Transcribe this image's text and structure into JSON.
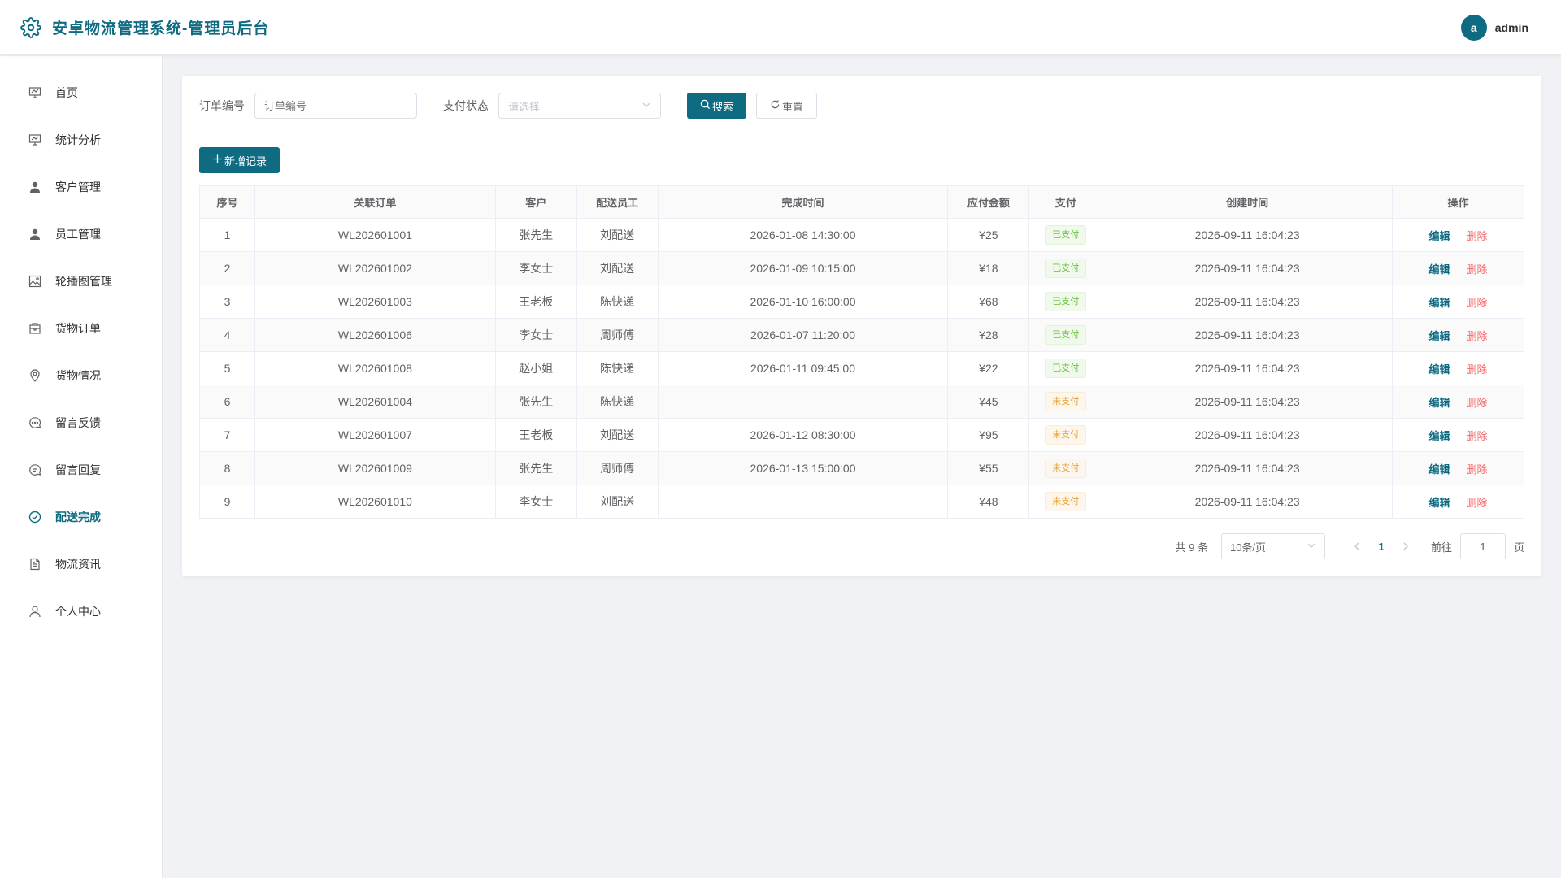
{
  "header": {
    "title": "安卓物流管理系统-管理员后台",
    "avatar_letter": "a",
    "username": "admin"
  },
  "sidebar": {
    "items": [
      {
        "label": "首页",
        "icon": "presentation-icon"
      },
      {
        "label": "统计分析",
        "icon": "presentation-icon"
      },
      {
        "label": "客户管理",
        "icon": "user-icon"
      },
      {
        "label": "员工管理",
        "icon": "user-icon"
      },
      {
        "label": "轮播图管理",
        "icon": "image-icon"
      },
      {
        "label": "货物订单",
        "icon": "box-icon"
      },
      {
        "label": "货物情况",
        "icon": "location-icon"
      },
      {
        "label": "留言反馈",
        "icon": "chat-dots-icon"
      },
      {
        "label": "留言回复",
        "icon": "chat-icon"
      },
      {
        "label": "配送完成",
        "icon": "circle-check-icon",
        "active": true
      },
      {
        "label": "物流资讯",
        "icon": "document-icon"
      },
      {
        "label": "个人中心",
        "icon": "user-outline-icon"
      }
    ]
  },
  "filters": {
    "order_label": "订单编号",
    "order_placeholder": "订单编号",
    "pay_label": "支付状态",
    "pay_placeholder": "请选择",
    "search_label": "搜索",
    "reset_label": "重置"
  },
  "add_label": "新增记录",
  "table": {
    "headers": [
      "序号",
      "关联订单",
      "客户",
      "配送员工",
      "完成时间",
      "应付金额",
      "支付",
      "创建时间",
      "操作"
    ],
    "edit_label": "编辑",
    "delete_label": "删除",
    "rows": [
      {
        "no": "1",
        "order": "WL202601001",
        "customer": "张先生",
        "staff": "刘配送",
        "done": "2026-01-08 14:30:00",
        "amount": "¥25",
        "pay": "已支付",
        "paid": true,
        "created": "2026-09-11 16:04:23"
      },
      {
        "no": "2",
        "order": "WL202601002",
        "customer": "李女士",
        "staff": "刘配送",
        "done": "2026-01-09 10:15:00",
        "amount": "¥18",
        "pay": "已支付",
        "paid": true,
        "created": "2026-09-11 16:04:23"
      },
      {
        "no": "3",
        "order": "WL202601003",
        "customer": "王老板",
        "staff": "陈快递",
        "done": "2026-01-10 16:00:00",
        "amount": "¥68",
        "pay": "已支付",
        "paid": true,
        "created": "2026-09-11 16:04:23"
      },
      {
        "no": "4",
        "order": "WL202601006",
        "customer": "李女士",
        "staff": "周师傅",
        "done": "2026-01-07 11:20:00",
        "amount": "¥28",
        "pay": "已支付",
        "paid": true,
        "created": "2026-09-11 16:04:23"
      },
      {
        "no": "5",
        "order": "WL202601008",
        "customer": "赵小姐",
        "staff": "陈快递",
        "done": "2026-01-11 09:45:00",
        "amount": "¥22",
        "pay": "已支付",
        "paid": true,
        "created": "2026-09-11 16:04:23"
      },
      {
        "no": "6",
        "order": "WL202601004",
        "customer": "张先生",
        "staff": "陈快递",
        "done": "",
        "amount": "¥45",
        "pay": "未支付",
        "paid": false,
        "created": "2026-09-11 16:04:23"
      },
      {
        "no": "7",
        "order": "WL202601007",
        "customer": "王老板",
        "staff": "刘配送",
        "done": "2026-01-12 08:30:00",
        "amount": "¥95",
        "pay": "未支付",
        "paid": false,
        "created": "2026-09-11 16:04:23"
      },
      {
        "no": "8",
        "order": "WL202601009",
        "customer": "张先生",
        "staff": "周师傅",
        "done": "2026-01-13 15:00:00",
        "amount": "¥55",
        "pay": "未支付",
        "paid": false,
        "created": "2026-09-11 16:04:23"
      },
      {
        "no": "9",
        "order": "WL202601010",
        "customer": "李女士",
        "staff": "刘配送",
        "done": "",
        "amount": "¥48",
        "pay": "未支付",
        "paid": false,
        "created": "2026-09-11 16:04:23"
      }
    ]
  },
  "pagination": {
    "total_text": "共 9 条",
    "page_size": "10条/页",
    "current_page": "1",
    "goto_label": "前往",
    "goto_value": "1",
    "page_suffix": "页"
  },
  "colors": {
    "accent": "#0e6b82",
    "paid": "#67c23a",
    "unpaid": "#e6a23c",
    "danger": "#f56c6c"
  }
}
